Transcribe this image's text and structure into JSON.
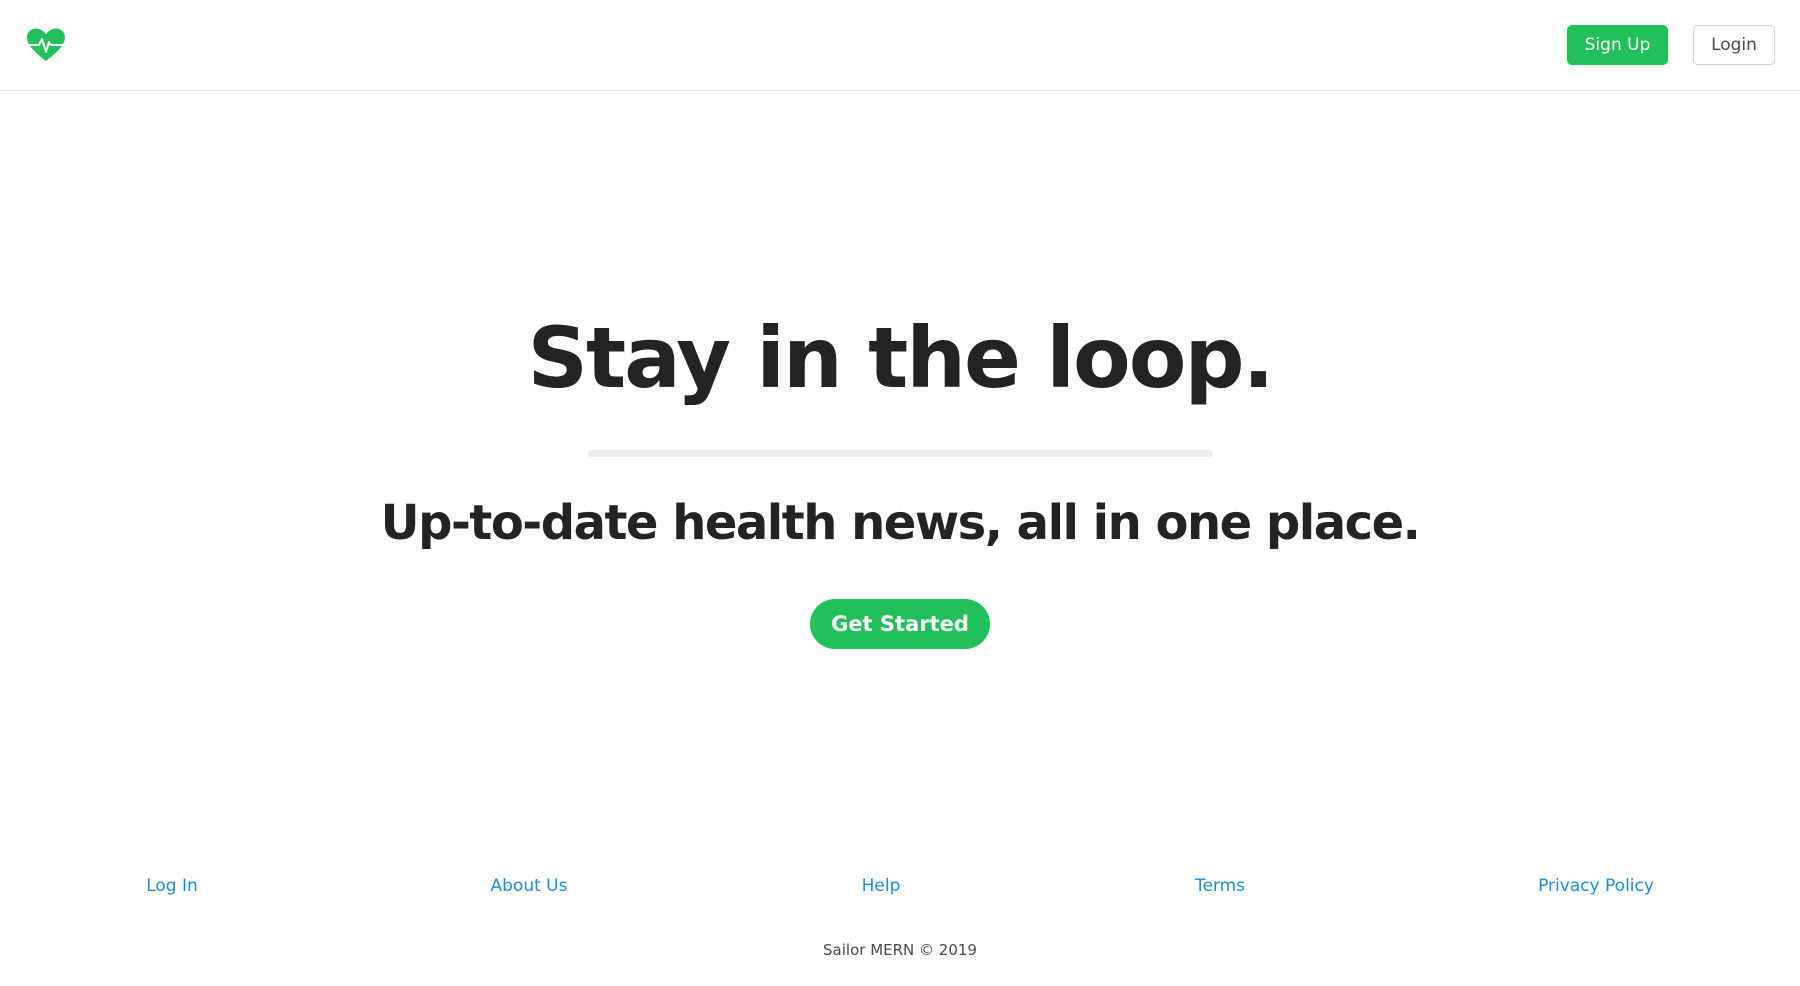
{
  "header": {
    "logo_icon": "heart-pulse-icon",
    "brand_color": "#22c05a",
    "signup_label": "Sign Up",
    "login_label": "Login"
  },
  "hero": {
    "title": "Stay in the loop.",
    "subtitle": "Up-to-date health news, all in one place.",
    "cta_label": "Get Started"
  },
  "footer": {
    "links": [
      {
        "label": "Log In"
      },
      {
        "label": "About Us"
      },
      {
        "label": "Help"
      },
      {
        "label": "Terms"
      },
      {
        "label": "Privacy Policy"
      }
    ],
    "link_color": "#1a8fd9",
    "copyright": "Sailor MERN © 2019"
  }
}
